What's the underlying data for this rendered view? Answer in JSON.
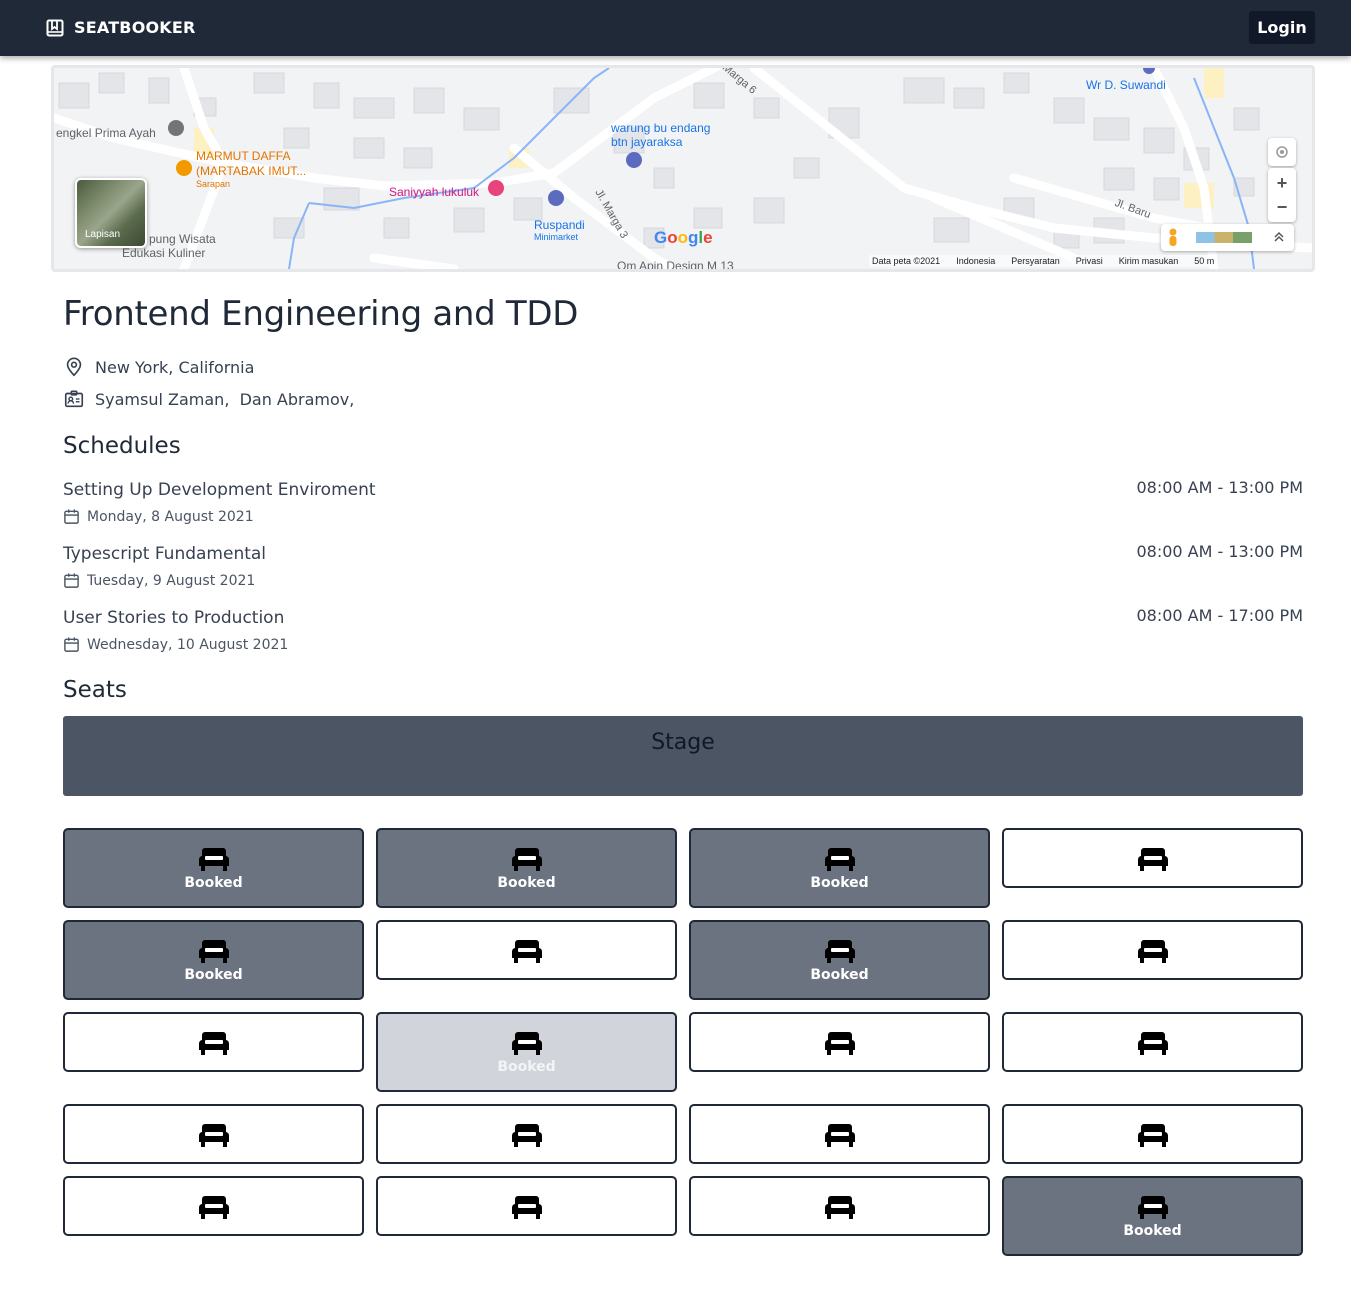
{
  "navbar": {
    "brand": "SEATBOOKER",
    "login_label": "Login"
  },
  "map": {
    "labels": {
      "bengkel": "engkel Prima Ayah",
      "marmut1": "MARMUT DAFFA",
      "marmut2": "(MARTABAK IMUT...",
      "sarapan": "Sarapan",
      "saniyyah": "Saniyyah lukuluk",
      "warung1": "warung bu endang",
      "warung2": "btn jayaraksa",
      "ruspandi": "Ruspandi",
      "minimarket": "Minimarket",
      "marga3": "Jl. Marga 3",
      "marga6": "Marga 6",
      "suwandi": "Wr D. Suwandi",
      "jlbaru": "Jl. Baru",
      "kampung1": "pung Wisata",
      "kampung2": "Edukasi Kuliner",
      "omapin": "Om Apin Design M 13",
      "layer": "Lapisan"
    },
    "google": "Google",
    "attribution": [
      "Data peta ©2021",
      "Indonesia",
      "Persyaratan",
      "Privasi",
      "Kirim masukan",
      "50 m"
    ],
    "zoom_in": "+",
    "zoom_out": "−"
  },
  "event": {
    "title": "Frontend Engineering and TDD",
    "location": "New York, California",
    "speakers": "Syamsul Zaman,  Dan Abramov,"
  },
  "schedules_heading": "Schedules",
  "schedules": [
    {
      "title": "Setting Up Development Enviroment",
      "date": "Monday, 8 August 2021",
      "time": "08:00 AM - 13:00 PM"
    },
    {
      "title": "Typescript Fundamental",
      "date": "Tuesday, 9 August 2021",
      "time": "08:00 AM - 13:00 PM"
    },
    {
      "title": "User Stories to Production",
      "date": "Wednesday, 10 August 2021",
      "time": "08:00 AM - 17:00 PM"
    }
  ],
  "seats_heading": "Seats",
  "stage_label": "Stage",
  "booked_label": "Booked",
  "seats": [
    [
      "booked",
      "booked",
      "booked",
      "available"
    ],
    [
      "booked",
      "available",
      "booked",
      "available"
    ],
    [
      "available",
      "pending",
      "available",
      "available"
    ],
    [
      "available",
      "available",
      "available",
      "available"
    ],
    [
      "available",
      "available",
      "available",
      "booked"
    ]
  ],
  "colors": {
    "navbar": "#1f2937",
    "booked": "#6b7280",
    "pending": "#d1d5db",
    "stage": "#4b5563"
  }
}
